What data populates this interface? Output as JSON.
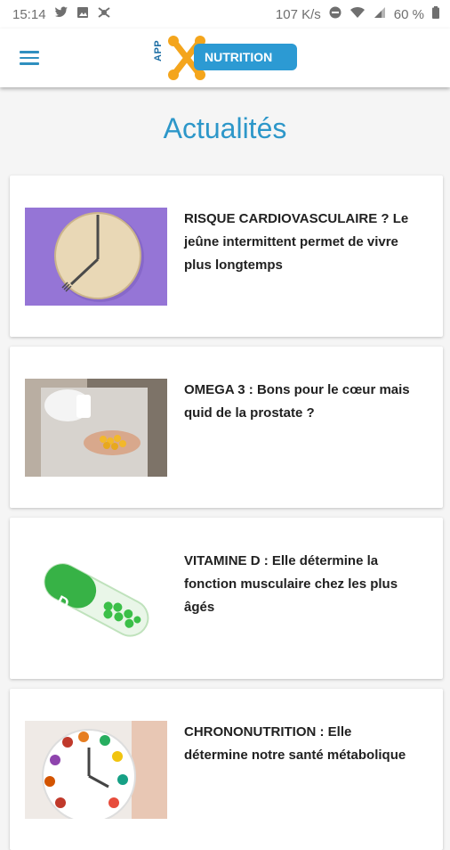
{
  "status_bar": {
    "time": "15:14",
    "network_speed": "107 K/s",
    "battery": "60 %",
    "icons_left": [
      "twitter-icon",
      "image-icon",
      "app-icon"
    ],
    "icons_right": [
      "dnd-icon",
      "wifi-icon",
      "signal-icon",
      "battery-icon"
    ]
  },
  "app_bar": {
    "logo_prefix": "APP",
    "logo_text": "NUTRITION",
    "menu_icon": "hamburger-menu-icon"
  },
  "page": {
    "title": "Actualités"
  },
  "articles": [
    {
      "title": "RISQUE CARDIOVASCULAIRE ? Le jeûne intermittent permet de vivre plus longtemps",
      "image": "clock-plate-image"
    },
    {
      "title": "OMEGA 3 : Bons pour le cœur mais quid de la prostate ?",
      "image": "omega3-capsules-image"
    },
    {
      "title": "VITAMINE D : Elle détermine la fonction musculaire chez les plus âgés",
      "image": "vitamin-d-capsule-image"
    },
    {
      "title": "CHRONONUTRITION : Elle détermine notre santé métabolique",
      "image": "food-plate-clock-image"
    }
  ],
  "colors": {
    "accent": "#2d97c9",
    "logo_orange": "#f4a51c",
    "logo_blue": "#2c9ad3"
  }
}
